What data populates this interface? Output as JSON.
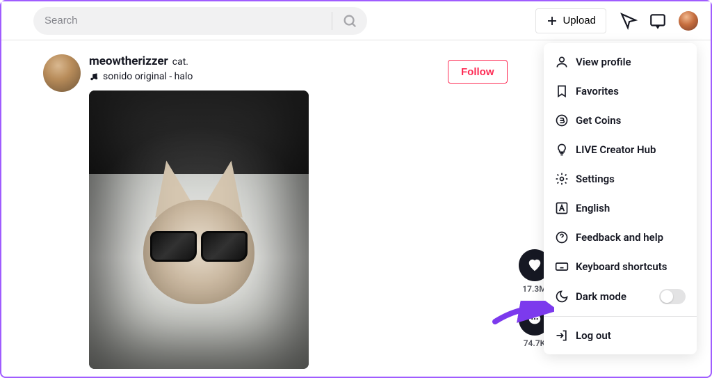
{
  "header": {
    "search_placeholder": "Search",
    "upload_label": "Upload"
  },
  "post": {
    "username": "meowtherizzer",
    "display_name": "cat.",
    "sound_label": "sonido original - halo",
    "follow_label": "Follow",
    "like_count": "17.3M",
    "comment_count": "74.7K"
  },
  "menu": {
    "items": [
      {
        "id": "view-profile",
        "label": "View profile",
        "icon": "user"
      },
      {
        "id": "favorites",
        "label": "Favorites",
        "icon": "bookmark"
      },
      {
        "id": "get-coins",
        "label": "Get Coins",
        "icon": "coin"
      },
      {
        "id": "live-hub",
        "label": "LIVE Creator Hub",
        "icon": "bulb"
      },
      {
        "id": "settings",
        "label": "Settings",
        "icon": "gear"
      },
      {
        "id": "language",
        "label": "English",
        "icon": "letter-a"
      },
      {
        "id": "feedback",
        "label": "Feedback and help",
        "icon": "question"
      },
      {
        "id": "keyboard",
        "label": "Keyboard shortcuts",
        "icon": "keyboard"
      },
      {
        "id": "dark-mode",
        "label": "Dark mode",
        "icon": "moon",
        "toggle": false
      }
    ],
    "logout_label": "Log out"
  }
}
